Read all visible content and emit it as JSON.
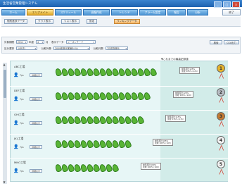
{
  "window": {
    "title": "生活省営業管理システム",
    "controls": [
      "_",
      "□",
      "×"
    ]
  },
  "main_nav": {
    "tabs": [
      "ホーム",
      "エリアメイト",
      "スケジュール",
      "週報作成",
      "トレンド",
      "アラーム設定",
      "報告",
      "分析"
    ],
    "active_index": 1,
    "end_label": "終了"
  },
  "sub_toolbar": {
    "buttons": [
      "個別進捗データ",
      "グラフ表示",
      "リスト表示",
      "設定"
    ],
    "highlight_button": "ランキングデータ"
  },
  "filters": {
    "row1": {
      "label_a": "対象期間",
      "value_a": "2011",
      "unit_a": "年度",
      "value_b": "4",
      "unit_b": "月",
      "label_c": "表示データ",
      "value_c": "シーズンモード"
    },
    "row2": {
      "label_a": "区分選択",
      "value_a": "1(全店)",
      "label_b": "比較対象",
      "value_b": "2009年度比実績比(%)",
      "label_c": "比較月数",
      "value_c": "7月前年度比"
    },
    "btn_search": "検索",
    "btn_csv": "CSV出力"
  },
  "ranking": {
    "goal_label": "▼これまでの最高記録値",
    "rows": [
      {
        "name": "ABC工場",
        "small": "7ps",
        "detail": "詳細表示",
        "leaf_count": 16,
        "info": [
          "前年度比125%",
          "達成 125% (125)"
        ],
        "rank": "1",
        "medal_color": "#e8b52a"
      },
      {
        "name": "DEF工場",
        "small": "7ps",
        "detail": "詳細表示",
        "leaf_count": 15,
        "info": [
          "前年度比120%",
          "達成 120% (120)"
        ],
        "rank": "2",
        "medal_color": "#b9bec5"
      },
      {
        "name": "GHI工場",
        "small": "7ps",
        "detail": "詳細表示",
        "leaf_count": 14,
        "info": [
          "前年度比115%",
          "達成 115% (115)"
        ],
        "rank": "3",
        "medal_color": "#c57a32"
      },
      {
        "name": "JKL工場",
        "small": "7ps",
        "detail": "詳細表示",
        "leaf_count": 12,
        "info": [
          "前年度比105%",
          "達成 105% (105)"
        ],
        "rank": "4",
        "medal_color": "#f2f2f2"
      },
      {
        "name": "MNO工場",
        "small": "7ps",
        "detail": "詳細表示",
        "leaf_count": 10,
        "info": [
          "前年度比100%",
          "達成 100% (100)"
        ],
        "rank": "5",
        "medal_color": "#f2f2f2"
      }
    ]
  }
}
